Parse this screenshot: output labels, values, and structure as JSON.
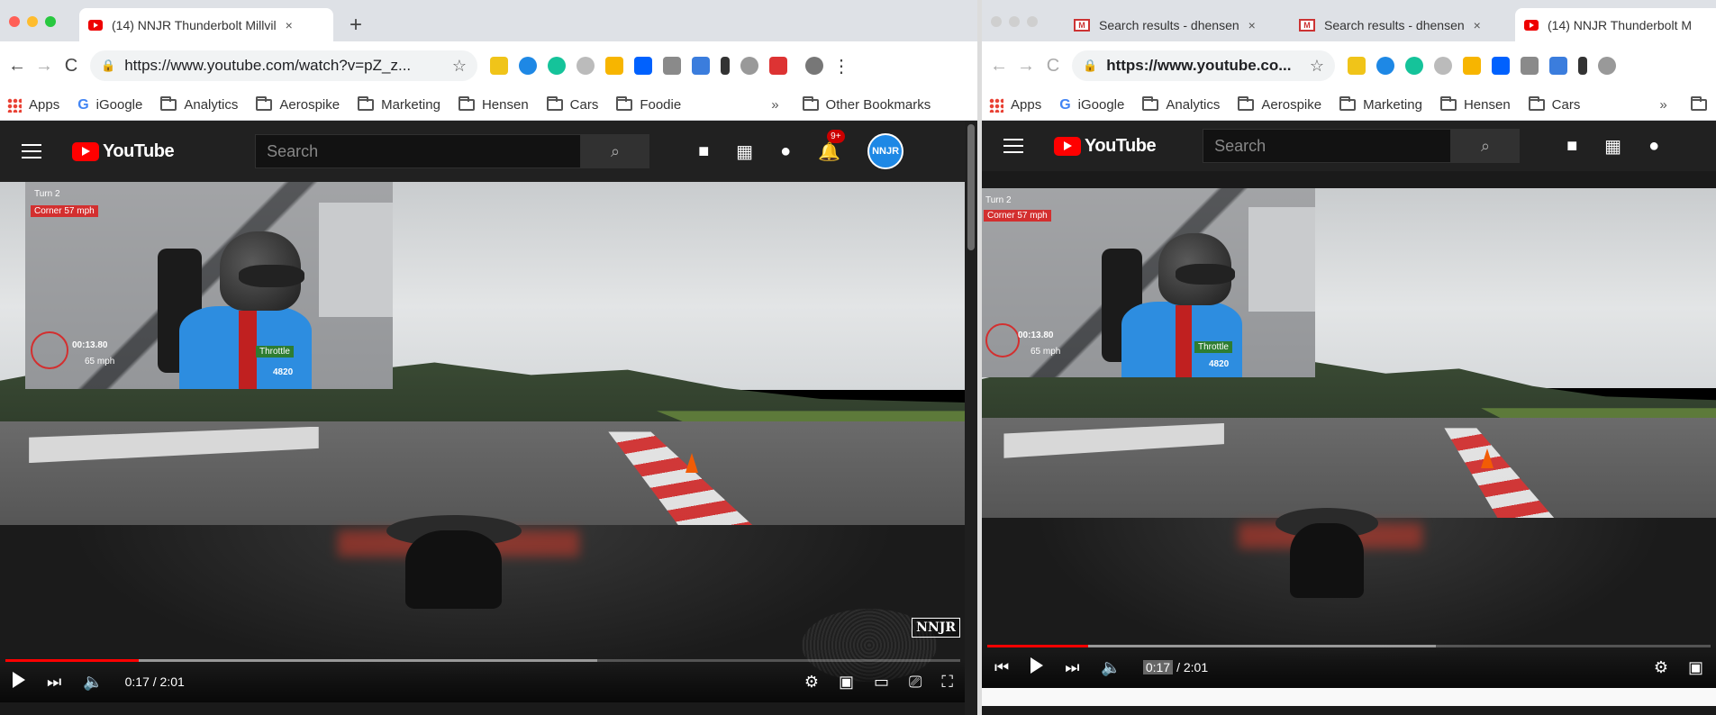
{
  "left_window": {
    "tab": {
      "title": "(14) NNJR Thunderbolt Millvil",
      "close": "×"
    },
    "new_tab": "+",
    "nav": {
      "back": "←",
      "forward": "→",
      "reload": "C"
    },
    "url": "https://www.youtube.com/watch?v=pZ_z...",
    "star": "☆",
    "menu": "⋮",
    "bookmarks": [
      "Apps",
      "iGoogle",
      "Analytics",
      "Aerospike",
      "Marketing",
      "Hensen",
      "Cars",
      "Foodie"
    ],
    "bookmarks_overflow": "»",
    "other_bookmarks": "Other Bookmarks",
    "youtube": {
      "logo": "YouTube",
      "search_placeholder": "Search",
      "notification_badge": "9+",
      "avatar_text": "NNJR",
      "video": {
        "pip_turn": "Turn 2",
        "pip_corner": "Corner 57 mph",
        "pip_lap_time": "00:13.80",
        "pip_speed": "65 mph",
        "pip_throttle": "Throttle",
        "pip_rpm": "4820",
        "watermark": "NNJR"
      },
      "player": {
        "time": "0:17 / 2:01",
        "progress": 0.14,
        "buffered": 0.62
      }
    }
  },
  "right_window": {
    "tabs": [
      {
        "title": "Search results - dhensen",
        "close": "×"
      },
      {
        "title": "Search results - dhensen",
        "close": "×"
      },
      {
        "title": "(14) NNJR Thunderbolt M"
      }
    ],
    "nav": {
      "back": "←",
      "forward": "→",
      "reload": "C"
    },
    "url": "https://www.youtube.co...",
    "star": "☆",
    "bookmarks": [
      "Apps",
      "iGoogle",
      "Analytics",
      "Aerospike",
      "Marketing",
      "Hensen",
      "Cars"
    ],
    "bookmarks_overflow": "»",
    "youtube": {
      "logo": "YouTube",
      "search_placeholder": "Search",
      "video": {
        "pip_turn": "Turn 2",
        "pip_corner": "Corner 57 mph",
        "pip_lap_time": "00:13.80",
        "pip_speed": "65 mph",
        "pip_throttle": "Throttle",
        "pip_rpm": "4820"
      },
      "player": {
        "time_current": "0:17",
        "time_total": "/ 2:01",
        "progress": 0.14,
        "buffered": 0.62
      }
    }
  },
  "colors": {
    "youtube_red": "#ff0000",
    "yt_dark": "#212121",
    "tab_bar": "#dee1e6"
  }
}
